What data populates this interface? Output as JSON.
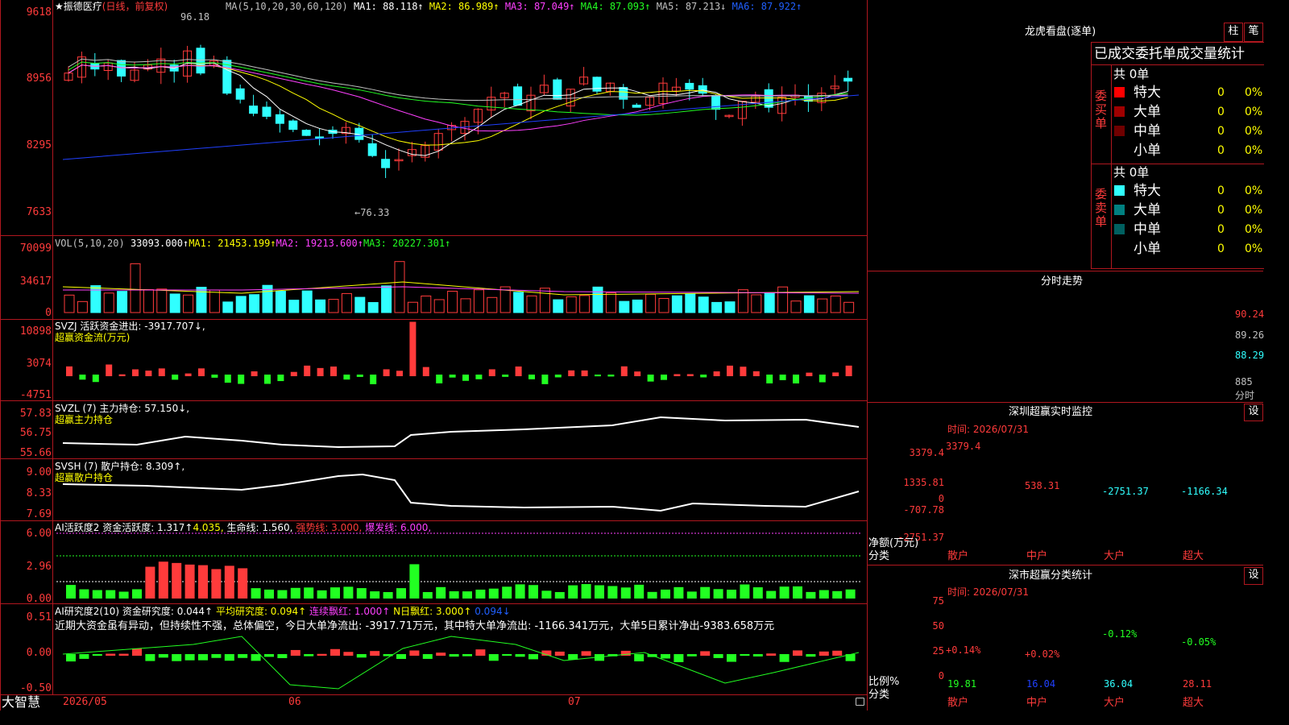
{
  "colors": {
    "up": "#ff3b3b",
    "down": "#30ffff",
    "grid": "#b0171f",
    "ma1": "#ffffff",
    "ma2": "#ffff00",
    "ma3": "#ff40ff",
    "ma4": "#22ff22",
    "ma5": "#c0c0c0",
    "ma6": "#2040ff"
  },
  "price_panel": {
    "star": "★",
    "stock_name": "振德医疗",
    "period": "(日线，前复权)",
    "ma_label": "MA(5,10,20,30,60,120)",
    "ma1": "MA1: 88.118↑",
    "ma2": "MA2: 86.989↑",
    "ma3": "MA3: 87.049↑",
    "ma4": "MA4: 87.093↑",
    "ma5": "MA5: 87.213↓",
    "ma6": "MA6: 87.922↑",
    "axis": [
      "9618",
      "8956",
      "8295",
      "7633"
    ],
    "high_label": "96.18",
    "low_label": "←76.33"
  },
  "vol_panel": {
    "label": "VOL(5,10,20)",
    "value": "33093.000↑",
    "ma1": "MA1: 21453.199↑",
    "ma2": "MA2: 19213.600↑",
    "ma3": "MA3: 20227.301↑",
    "axis": [
      "70099",
      "34617",
      "0"
    ]
  },
  "svzj_panel": {
    "label": "SVZJ  活跃资金进出: -3917.707↓,",
    "sub": "超赢资金流(万元)",
    "axis": [
      "10898",
      "3074",
      "-4751"
    ]
  },
  "svzl_panel": {
    "label": "SVZL (7) 主力持仓: 57.150↓,",
    "sub": "超赢主力持仓",
    "axis": [
      "57.83",
      "56.75",
      "55.66"
    ]
  },
  "svsh_panel": {
    "label": "SVSH (7) 散户持仓: 8.309↑,",
    "sub": "超赢散户持仓",
    "axis": [
      "9.00",
      "8.33",
      "7.69"
    ]
  },
  "ai1_panel": {
    "label": "AI活跃度2 资金活跃度: 1.317↑",
    "v2": "4.035,",
    "life": "生命线: 1.560,",
    "strong": "强势线: 3.000,",
    "burst": "爆发线: 6.000,",
    "axis": [
      "6.00",
      "2.96",
      "0.00"
    ]
  },
  "ai2_panel": {
    "label": "AI研究度2(10) 资金研究度: 0.044↑",
    "avg": "平均研究度: 0.094↑",
    "red": "连续飘红: 1.000↑",
    "nred": "N日飘红: 3.000↑",
    "last": "0.094↓",
    "comment": "近期大资金虽有异动，但持续性不强，总体偏空，今日大单净流出: -3917.71万元，其中特大单净流出: -1166.341万元，大单5日累计净出-9383.658万元",
    "axis": [
      "0.51",
      "0.00",
      "-0.50"
    ]
  },
  "bottom_bar": {
    "logo": "大智慧",
    "dates": [
      "2026/05",
      "06",
      "07"
    ]
  },
  "dragon": {
    "title": "龙虎看盘(逐单)",
    "btn1": "柱",
    "btn2": "笔",
    "header": "已成交委托单成交量统计",
    "buy_side": "委买单",
    "sell_side": "委卖单",
    "buy_total": "共 0单",
    "sell_total": "共 0单",
    "buy_rows": [
      {
        "label": "特大",
        "count": "0",
        "pct": "0%",
        "color": "#ff0000"
      },
      {
        "label": "大单",
        "count": "0",
        "pct": "0%",
        "color": "#a00000"
      },
      {
        "label": "中单",
        "count": "0",
        "pct": "0%",
        "color": "#700000"
      },
      {
        "label": "小单",
        "count": "0",
        "pct": "0%",
        "color": "#000000"
      }
    ],
    "sell_rows": [
      {
        "label": "特大",
        "count": "0",
        "pct": "0%",
        "color": "#30ffff"
      },
      {
        "label": "大单",
        "count": "0",
        "pct": "0%",
        "color": "#008080"
      },
      {
        "label": "中单",
        "count": "0",
        "pct": "0%",
        "color": "#006060"
      },
      {
        "label": "小单",
        "count": "0",
        "pct": "0%",
        "color": "#000000"
      }
    ]
  },
  "intraday": {
    "title": "分时走势",
    "axis": [
      "90.24",
      "89.26",
      "88.29",
      "885"
    ],
    "unit": "分时"
  },
  "sz_monitor": {
    "title": "深圳超赢实时监控",
    "btn": "设",
    "time": "时间: 2026/07/31",
    "axis": [
      "3379.4",
      "1335.81",
      "0",
      "-707.78",
      "-2751.37"
    ],
    "unit": "净额(万元)",
    "cat_label": "分类",
    "bars": [
      {
        "cat": "散户",
        "value": 3379.4,
        "label": "3379.4"
      },
      {
        "cat": "中户",
        "value": 538.31,
        "label": "538.31"
      },
      {
        "cat": "大户",
        "value": -2751.37,
        "label": "-2751.37"
      },
      {
        "cat": "超大",
        "value": -1166.34,
        "label": "-1166.34"
      }
    ]
  },
  "sz_class": {
    "title": "深市超赢分类统计",
    "btn": "设",
    "time": "时间: 2026/07/31",
    "axis": [
      "75",
      "50",
      "25",
      "0"
    ],
    "unit": "比例%",
    "cat_label": "分类",
    "bars": [
      {
        "cat": "散户",
        "value": 19.81,
        "label": "19.81",
        "chg": "+0.14%"
      },
      {
        "cat": "中户",
        "value": 16.04,
        "label": "16.04",
        "chg": "+0.02%"
      },
      {
        "cat": "大户",
        "value": 36.04,
        "label": "36.04",
        "chg": "-0.12%"
      },
      {
        "cat": "超大",
        "value": 28.11,
        "label": "28.11",
        "chg": "-0.05%"
      }
    ]
  }
}
